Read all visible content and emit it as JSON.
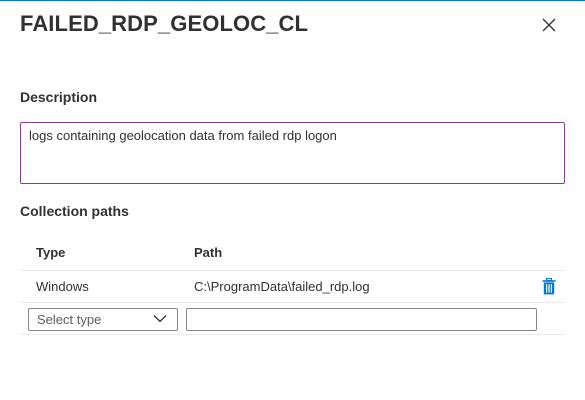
{
  "panel": {
    "title": "FAILED_RDP_GEOLOC_CL",
    "close_icon": "close-icon"
  },
  "description": {
    "label": "Description",
    "value": "logs containing geolocation data from failed rdp logon"
  },
  "collection_paths": {
    "label": "Collection paths",
    "columns": [
      "Type",
      "Path"
    ],
    "rows": [
      {
        "type": "Windows",
        "path": "C:\\ProgramData\\failed_rdp.log",
        "delete_icon": "trash-icon"
      }
    ],
    "new_row": {
      "type_placeholder": "Select type",
      "path_value": ""
    }
  },
  "colors": {
    "accent": "#0078d4",
    "focus_border": "#8a3b93",
    "delete_icon": "#0078d4"
  }
}
